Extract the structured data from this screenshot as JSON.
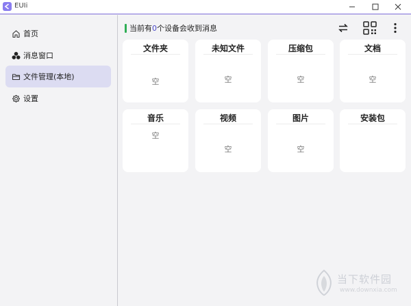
{
  "window": {
    "title": "EUIi",
    "icon": "app-logo-icon",
    "controls": [
      "minimize-icon",
      "maximize-icon",
      "close-icon"
    ]
  },
  "sidebar": {
    "items": [
      {
        "label": "首页",
        "icon": "home-icon",
        "active": false
      },
      {
        "label": "消息窗口",
        "icon": "message-cluster-icon",
        "active": false
      },
      {
        "label": "文件管理(本地)",
        "icon": "folder-icon",
        "active": true
      },
      {
        "label": "设置",
        "icon": "gear-icon",
        "active": false
      }
    ]
  },
  "status": {
    "prefix": "当前有",
    "count": "0",
    "suffix": "个设备会收到消息"
  },
  "toolbar": {
    "icons": [
      "swap-arrows-icon",
      "qr-code-icon",
      "more-vertical-icon"
    ]
  },
  "file_categories": [
    {
      "title": "文件夹",
      "empty_label": "空"
    },
    {
      "title": "未知文件",
      "empty_label": "空"
    },
    {
      "title": "压缩包",
      "empty_label": "空"
    },
    {
      "title": "文档",
      "empty_label": "空"
    },
    {
      "title": "音乐",
      "empty_label": "空"
    },
    {
      "title": "视频",
      "empty_label": "空"
    },
    {
      "title": "图片",
      "empty_label": "空"
    },
    {
      "title": "安装包",
      "empty_label": ""
    }
  ],
  "watermark": {
    "text": "当下软件园",
    "url": "www.downxia.com"
  },
  "colors": {
    "accent": "#7a6ad8",
    "active_nav": "#dcdcf2",
    "status_ok": "#2fae55",
    "count": "#4a48c8",
    "background": "#f3f3f5",
    "card": "#ffffff"
  }
}
